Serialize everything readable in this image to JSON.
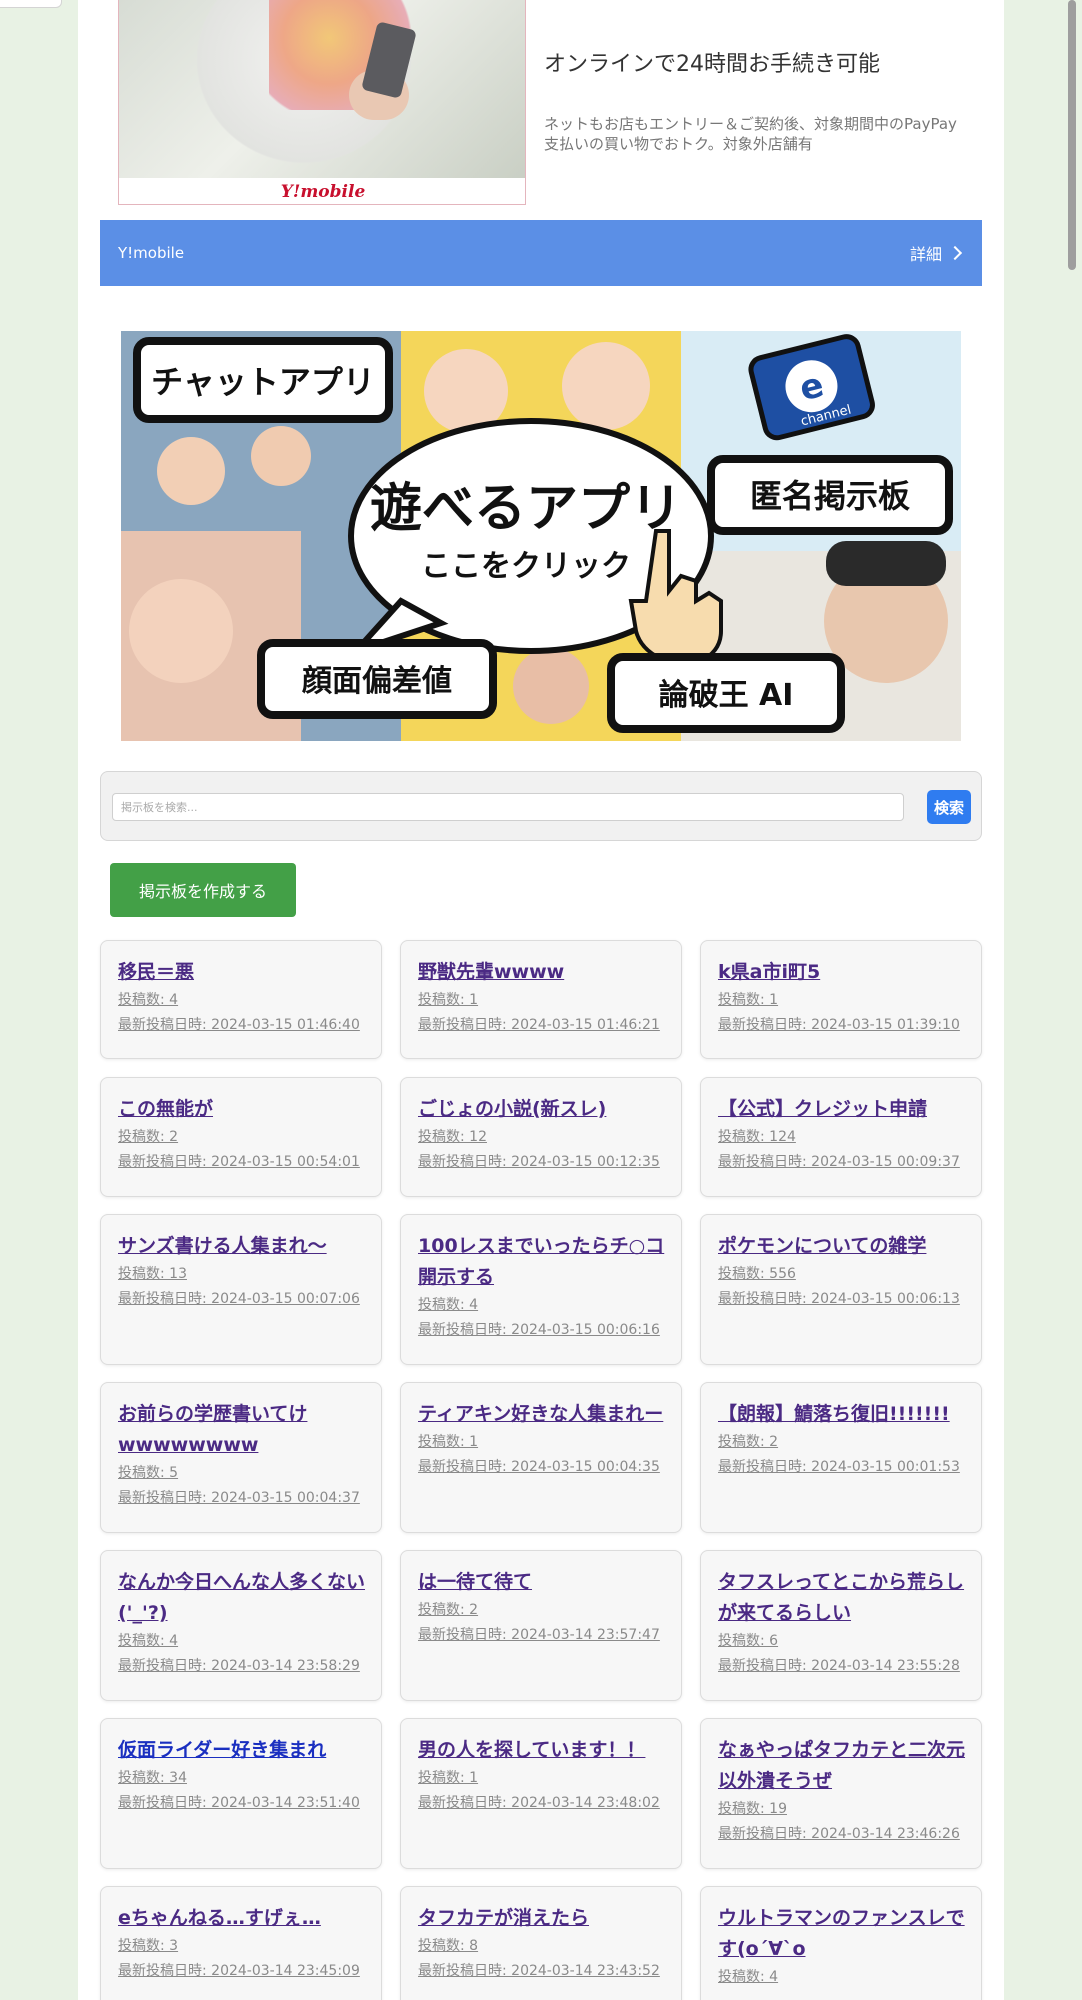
{
  "ad": {
    "logo": "Y!mobile",
    "headline": "オンラインで24時間お手続き可能",
    "body": "ネットもお店もエントリー＆ご契約後、対象期間中のPayPay支払いの買い物でおトク。対象外店舗有",
    "advertiser": "Y!mobile",
    "detail_label": "詳細"
  },
  "banner": {
    "chat_app": "チャットアプリ",
    "play_app": "遊べるアプリ",
    "click_here": "ここをクリック",
    "anon_board": "匿名掲示板",
    "face_score": "顔面偏差値",
    "ronpa_ai": "論破王 AI",
    "channel_logo": "channel"
  },
  "search": {
    "placeholder": "掲示板を検索...",
    "button_label": "検索"
  },
  "create_board_label": "掲示板を作成する",
  "threads": [
    {
      "title": "移民＝悪",
      "posts": "投稿数: 4",
      "latest": "最新投稿日時: 2024-03-15 01:46:40"
    },
    {
      "title": "野獣先輩wwww",
      "posts": "投稿数: 1",
      "latest": "最新投稿日時: 2024-03-15 01:46:21"
    },
    {
      "title": "k県a市i町5",
      "posts": "投稿数: 1",
      "latest": "最新投稿日時: 2024-03-15 01:39:10"
    },
    {
      "title": "この無能が",
      "posts": "投稿数: 2",
      "latest": "最新投稿日時: 2024-03-15 00:54:01"
    },
    {
      "title": "ごじょの小説(新スレ)",
      "posts": "投稿数: 12",
      "latest": "最新投稿日時: 2024-03-15 00:12:35"
    },
    {
      "title": "【公式】クレジット申請",
      "posts": "投稿数: 124",
      "latest": "最新投稿日時: 2024-03-15 00:09:37"
    },
    {
      "title": "サンズ書ける人集まれ〜",
      "posts": "投稿数: 13",
      "latest": "最新投稿日時: 2024-03-15 00:07:06"
    },
    {
      "title": "100レスまでいったらチ○コ開示する",
      "posts": "投稿数: 4",
      "latest": "最新投稿日時: 2024-03-15 00:06:16"
    },
    {
      "title": "ポケモンについての雑学",
      "posts": "投稿数: 556",
      "latest": "最新投稿日時: 2024-03-15 00:06:13"
    },
    {
      "title": "お前らの学歴書いてけwwwwwwww",
      "posts": "投稿数: 5",
      "latest": "最新投稿日時: 2024-03-15 00:04:37"
    },
    {
      "title": "ティアキン好きな人集まれー",
      "posts": "投稿数: 1",
      "latest": "最新投稿日時: 2024-03-15 00:04:35"
    },
    {
      "title": "【朗報】鯖落ち復旧!!!!!!!",
      "posts": "投稿数: 2",
      "latest": "最新投稿日時: 2024-03-15 00:01:53"
    },
    {
      "title": "なんか今日へんな人多くない('_'?)",
      "posts": "投稿数: 4",
      "latest": "最新投稿日時: 2024-03-14 23:58:29"
    },
    {
      "title": "は一待て待て",
      "posts": "投稿数: 2",
      "latest": "最新投稿日時: 2024-03-14 23:57:47"
    },
    {
      "title": "タフスレってとこから荒らしが来てるらしい",
      "posts": "投稿数: 6",
      "latest": "最新投稿日時: 2024-03-14 23:55:28"
    },
    {
      "title": "仮面ライダー好き集まれ",
      "posts": "投稿数: 34",
      "latest": "最新投稿日時: 2024-03-14 23:51:40"
    },
    {
      "title": "男の人を探しています！！",
      "posts": "投稿数: 1",
      "latest": "最新投稿日時: 2024-03-14 23:48:02"
    },
    {
      "title": "なぁやっぱタフカテと二次元以外潰そうぜ",
      "posts": "投稿数: 19",
      "latest": "最新投稿日時: 2024-03-14 23:46:26"
    },
    {
      "title": "eちゃんねる…すげぇ…",
      "posts": "投稿数: 3",
      "latest": "最新投稿日時: 2024-03-14 23:45:09"
    },
    {
      "title": "タフカテが消えたら",
      "posts": "投稿数: 8",
      "latest": "最新投稿日時: 2024-03-14 23:43:52"
    },
    {
      "title": "ウルトラマンのファンスレです(o´∀`o",
      "posts": "投稿数: 4",
      "latest": ""
    }
  ],
  "colors": {
    "visited_link": "#4b2a84",
    "unvisited_link": "#1a2fc0",
    "ad_footer": "#5b8fe6",
    "search_button": "#2f7cf0",
    "create_button": "#43a047",
    "page_background": "#e8f2e4"
  }
}
